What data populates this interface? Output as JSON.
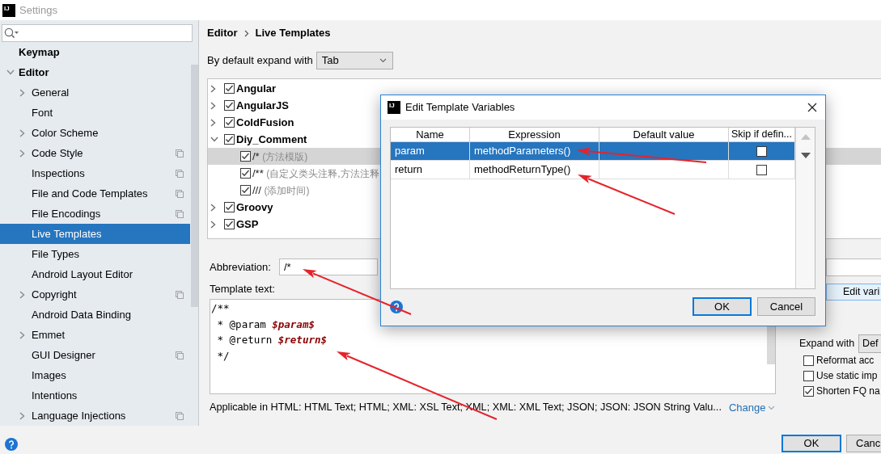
{
  "window": {
    "icon_text": "IJ",
    "title": "Settings"
  },
  "sidebar": {
    "items": [
      {
        "label": "Keymap",
        "expandable": false,
        "expanded": false,
        "project_level": false,
        "selected": false
      },
      {
        "label": "Editor",
        "expandable": true,
        "expanded": true,
        "project_level": false,
        "selected": false,
        "children": [
          {
            "label": "General",
            "expandable": true,
            "expanded": false,
            "project_level": false,
            "selected": false
          },
          {
            "label": "Font",
            "expandable": false,
            "expanded": false,
            "project_level": false,
            "selected": false
          },
          {
            "label": "Color Scheme",
            "expandable": true,
            "expanded": false,
            "project_level": false,
            "selected": false
          },
          {
            "label": "Code Style",
            "expandable": true,
            "expanded": false,
            "project_level": true,
            "selected": false
          },
          {
            "label": "Inspections",
            "expandable": false,
            "expanded": false,
            "project_level": true,
            "selected": false
          },
          {
            "label": "File and Code Templates",
            "expandable": false,
            "expanded": false,
            "project_level": true,
            "selected": false
          },
          {
            "label": "File Encodings",
            "expandable": false,
            "expanded": false,
            "project_level": true,
            "selected": false
          },
          {
            "label": "Live Templates",
            "expandable": false,
            "expanded": false,
            "project_level": false,
            "selected": true
          },
          {
            "label": "File Types",
            "expandable": false,
            "expanded": false,
            "project_level": false,
            "selected": false
          },
          {
            "label": "Android Layout Editor",
            "expandable": false,
            "expanded": false,
            "project_level": false,
            "selected": false
          },
          {
            "label": "Copyright",
            "expandable": true,
            "expanded": false,
            "project_level": true,
            "selected": false
          },
          {
            "label": "Android Data Binding",
            "expandable": false,
            "expanded": false,
            "project_level": false,
            "selected": false
          },
          {
            "label": "Emmet",
            "expandable": true,
            "expanded": false,
            "project_level": false,
            "selected": false
          },
          {
            "label": "GUI Designer",
            "expandable": false,
            "expanded": false,
            "project_level": true,
            "selected": false
          },
          {
            "label": "Images",
            "expandable": false,
            "expanded": false,
            "project_level": false,
            "selected": false
          },
          {
            "label": "Intentions",
            "expandable": false,
            "expanded": false,
            "project_level": false,
            "selected": false
          },
          {
            "label": "Language Injections",
            "expandable": true,
            "expanded": false,
            "project_level": true,
            "selected": false
          }
        ]
      }
    ]
  },
  "breadcrumb": [
    "Editor",
    "Live Templates"
  ],
  "default_expand": {
    "label": "By default expand with",
    "value": "Tab"
  },
  "template_tree": [
    {
      "label": "Angular",
      "checked": true,
      "expanded": false,
      "selected": false
    },
    {
      "label": "AngularJS",
      "checked": true,
      "expanded": false,
      "selected": false
    },
    {
      "label": "ColdFusion",
      "checked": true,
      "expanded": false,
      "selected": false
    },
    {
      "label": "Diy_Comment",
      "checked": true,
      "expanded": true,
      "selected": false,
      "children": [
        {
          "abbreviation": "/*",
          "description": "(方法模版)",
          "checked": true,
          "selected": true
        },
        {
          "abbreviation": "/**",
          "description": "(自定义类头注释,方法注释",
          "checked": true,
          "selected": false
        },
        {
          "abbreviation": "///",
          "description": "(添加时间)",
          "checked": true,
          "selected": false
        }
      ]
    },
    {
      "label": "Groovy",
      "checked": true,
      "expanded": false,
      "selected": false
    },
    {
      "label": "GSP",
      "checked": true,
      "expanded": false,
      "selected": false
    }
  ],
  "abbreviation": {
    "label": "Abbreviation:",
    "value": "/*"
  },
  "template_text": {
    "label": "Template text:",
    "lines": [
      {
        "text": "/**"
      },
      {
        "text": " * @param ",
        "variable": "$param$"
      },
      {
        "text": " * @return ",
        "variable": "$return$"
      },
      {
        "text": " */"
      }
    ]
  },
  "applicable": {
    "text": "Applicable in HTML: HTML Text; HTML; XML: XSL Text; XML; XML: XML Text; JSON; JSON: JSON String Valu...",
    "link": "Change"
  },
  "edit_variables_button": {
    "label": "Edit vari"
  },
  "options": {
    "expand_with": {
      "label": "Expand with",
      "value": "Def"
    },
    "checkboxes": [
      {
        "label": "Reformat acc",
        "checked": false
      },
      {
        "label": "Use static imp",
        "checked": false
      },
      {
        "label": "Shorten FQ na",
        "checked": true
      }
    ]
  },
  "buttons": [
    {
      "label": "OK",
      "default": true
    },
    {
      "label": "Canc",
      "default": false
    }
  ],
  "dialog": {
    "icon_text": "IJ",
    "title": "Edit Template Variables",
    "columns": [
      "Name",
      "Expression",
      "Default value",
      "Skip if defin..."
    ],
    "rows": [
      {
        "name": "param",
        "expression": "methodParameters()",
        "skip_if_defined": false,
        "selected": true
      },
      {
        "name": "return",
        "expression": "methodReturnType()",
        "skip_if_defined": false,
        "selected": false
      }
    ],
    "side_buttons": [
      {
        "kind": "up",
        "disabled": true
      },
      {
        "kind": "down",
        "disabled": false
      }
    ],
    "buttons": [
      {
        "label": "OK",
        "default": true
      },
      {
        "label": "Cancel",
        "default": false
      }
    ]
  },
  "annotations": [
    {
      "kind": "arrow"
    },
    {
      "kind": "arrow"
    },
    {
      "kind": "arrow"
    },
    {
      "kind": "arrow"
    }
  ]
}
